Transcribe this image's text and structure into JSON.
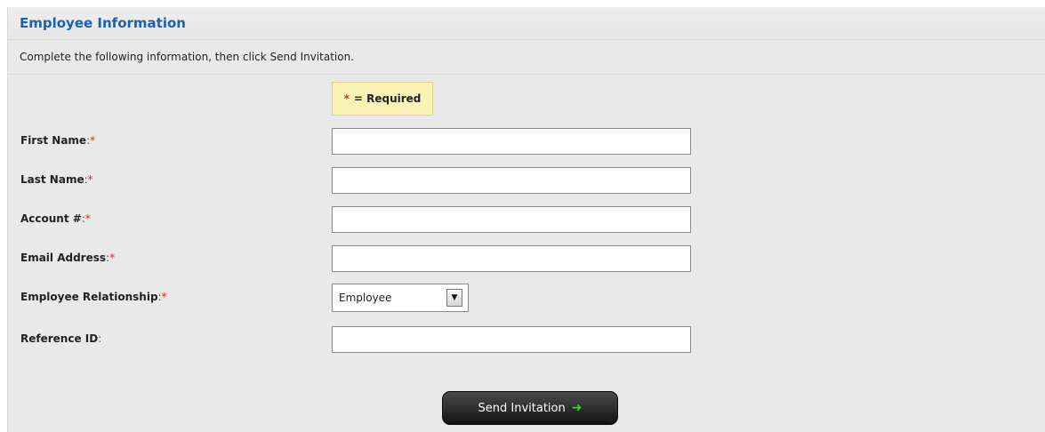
{
  "panel": {
    "title": "Employee Information",
    "instructions": "Complete the following information, then click Send Invitation."
  },
  "required_note": {
    "star": "*",
    "text": "= Required"
  },
  "fields": [
    {
      "label": "First Name",
      "colon": ":",
      "required": "*",
      "value": ""
    },
    {
      "label": "Last Name",
      "colon": ":",
      "required": "*",
      "value": ""
    },
    {
      "label": "Account #",
      "colon": ":",
      "required": "*",
      "value": ""
    },
    {
      "label": "Email Address",
      "colon": ":",
      "required": "*",
      "value": ""
    },
    {
      "label": "Employee Relationship",
      "colon": ":",
      "required": "*",
      "selected": "Employee"
    },
    {
      "label": "Reference ID",
      "colon": ":",
      "required": "",
      "value": ""
    }
  ],
  "submit": {
    "label": "Send Invitation",
    "icon": "arrow-right-icon",
    "icon_color": "#3fcf2a"
  },
  "colors": {
    "title": "#1f5fb0",
    "required_star": "#d42a2a",
    "panel_bg": "#e9e9e9",
    "note_bg": "#fbf3b5"
  }
}
